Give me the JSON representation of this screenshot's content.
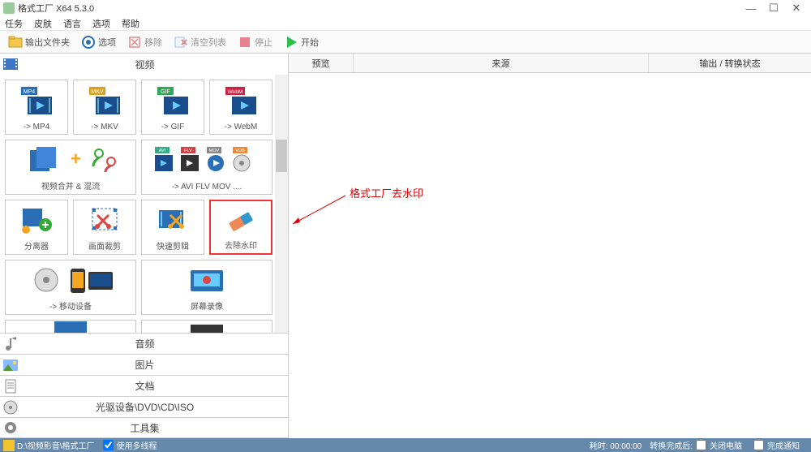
{
  "window": {
    "title": "格式工厂 X64 5.3.0",
    "min": "—",
    "max": "☐",
    "close": "✕"
  },
  "menu": [
    "任务",
    "皮肤",
    "语言",
    "选项",
    "帮助"
  ],
  "toolbar": {
    "outputFolder": "输出文件夹",
    "options": "选项",
    "remove": "移除",
    "clearList": "清空列表",
    "stop": "停止",
    "start": "开始"
  },
  "categories": {
    "video": "视频",
    "audio": "音频",
    "image": "图片",
    "document": "文档",
    "disc": "光驱设备\\DVD\\CD\\ISO",
    "toolset": "工具集"
  },
  "videoItems": {
    "mp4": "-> MP4",
    "mkv": "-> MKV",
    "gif": "-> GIF",
    "webm": "-> WebM",
    "mergeMix": "视频合并 & 混流",
    "aviFlvMov": "-> AVI FLV MOV ....",
    "splitter": "分离器",
    "crop": "画面裁剪",
    "quickCut": "快速剪辑",
    "removeWatermark": "去除水印",
    "mobile": "-> 移动设备",
    "screenRec": "屏幕录像"
  },
  "columns": {
    "preview": "预览",
    "source": "来源",
    "outputStatus": "输出 / 转换状态"
  },
  "annotation": "格式工厂去水印",
  "statusbar": {
    "path": "D:\\视频影音\\格式工厂",
    "multithread": "使用多线程",
    "time": "耗时: 00:00:00",
    "afterConvert": "转换完成后:",
    "shutdown": "关闭电脑",
    "notify": "完成通知"
  },
  "badges": {
    "mp4": "MP4",
    "mkv": "MKV",
    "gif": "GIF",
    "webm": "WebM",
    "avi": "AVI",
    "flv": "FLV",
    "mov": "MOV",
    "vob": "VOB"
  }
}
